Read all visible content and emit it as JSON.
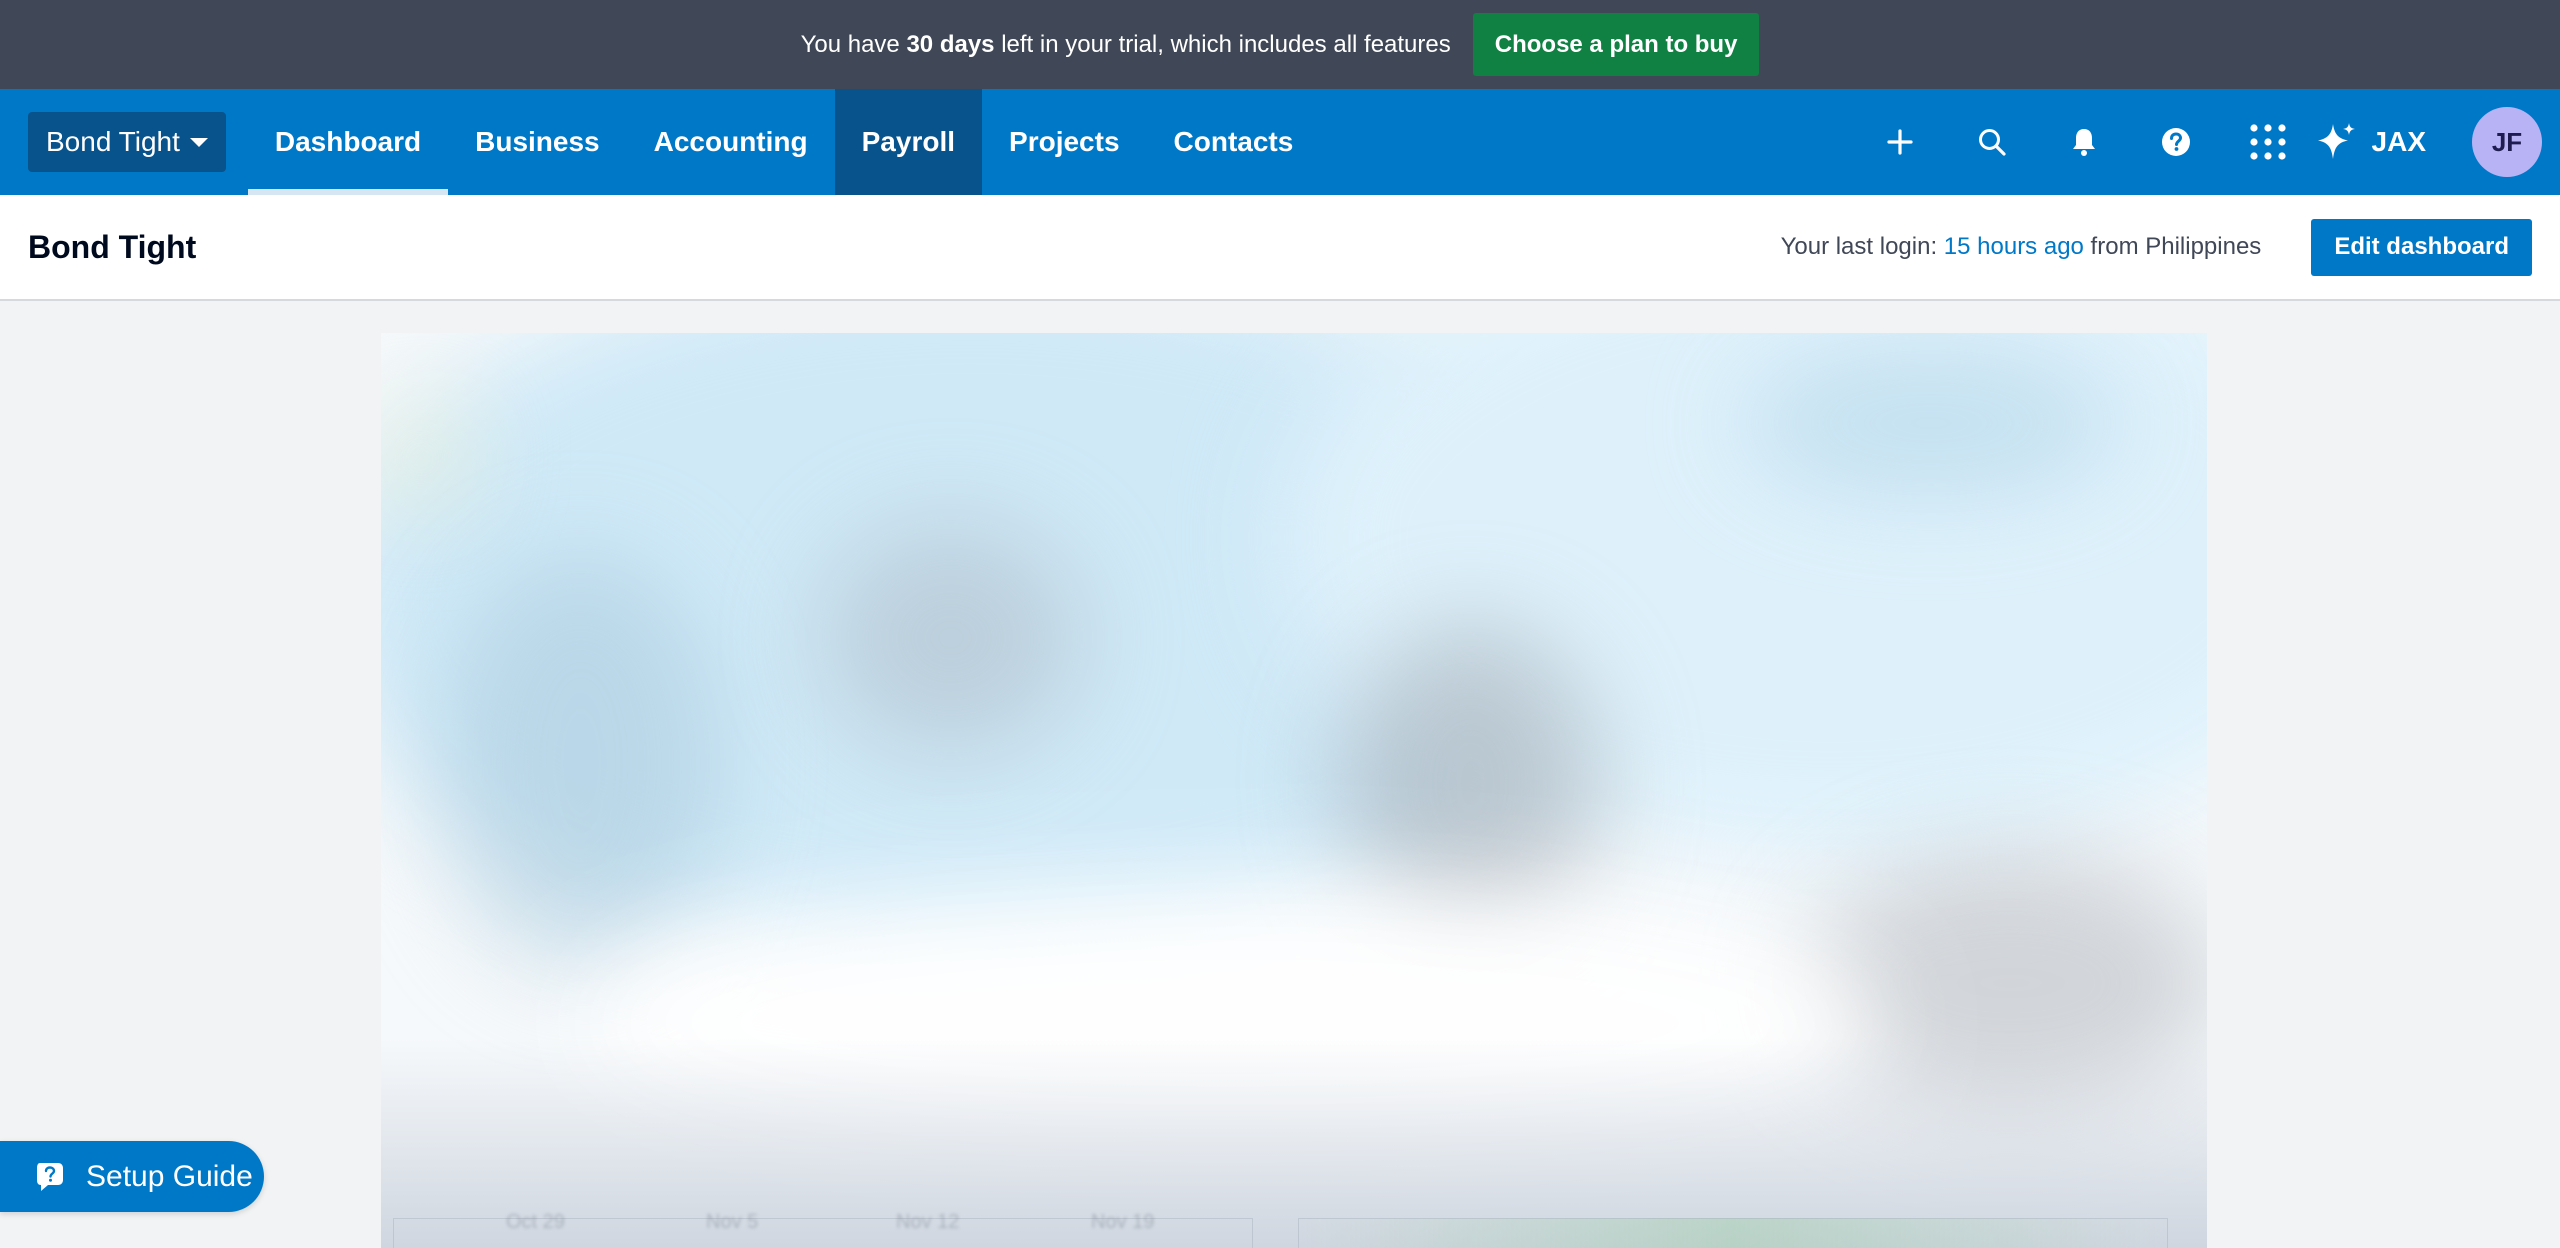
{
  "trial_banner": {
    "text_before": "You have ",
    "text_bold": "30 days",
    "text_after": " left in your trial, which includes all features",
    "cta_label": "Choose a plan to buy",
    "cta_color": "#108043"
  },
  "topnav": {
    "org_name": "Bond Tight",
    "tabs": [
      {
        "label": "Dashboard"
      },
      {
        "label": "Business"
      },
      {
        "label": "Accounting"
      },
      {
        "label": "Payroll"
      },
      {
        "label": "Projects"
      },
      {
        "label": "Contacts"
      }
    ],
    "icons": [
      "plus-icon",
      "search-icon",
      "bell-icon",
      "help-icon",
      "apps-grid-icon"
    ],
    "jax_label": "JAX",
    "avatar_initials": "JF",
    "brand_color": "#0078c8"
  },
  "page_header": {
    "title": "Bond Tight",
    "last_login_prefix": "Your last login: ",
    "last_login_time": "15 hours ago",
    "last_login_suffix": " from Philippines",
    "edit_button_label": "Edit dashboard"
  },
  "dashboard_ghost": {
    "axis_labels": [
      "Oct 29",
      "Nov 5",
      "Nov 12",
      "Nov 19"
    ]
  },
  "setup_guide": {
    "label": "Setup Guide"
  }
}
